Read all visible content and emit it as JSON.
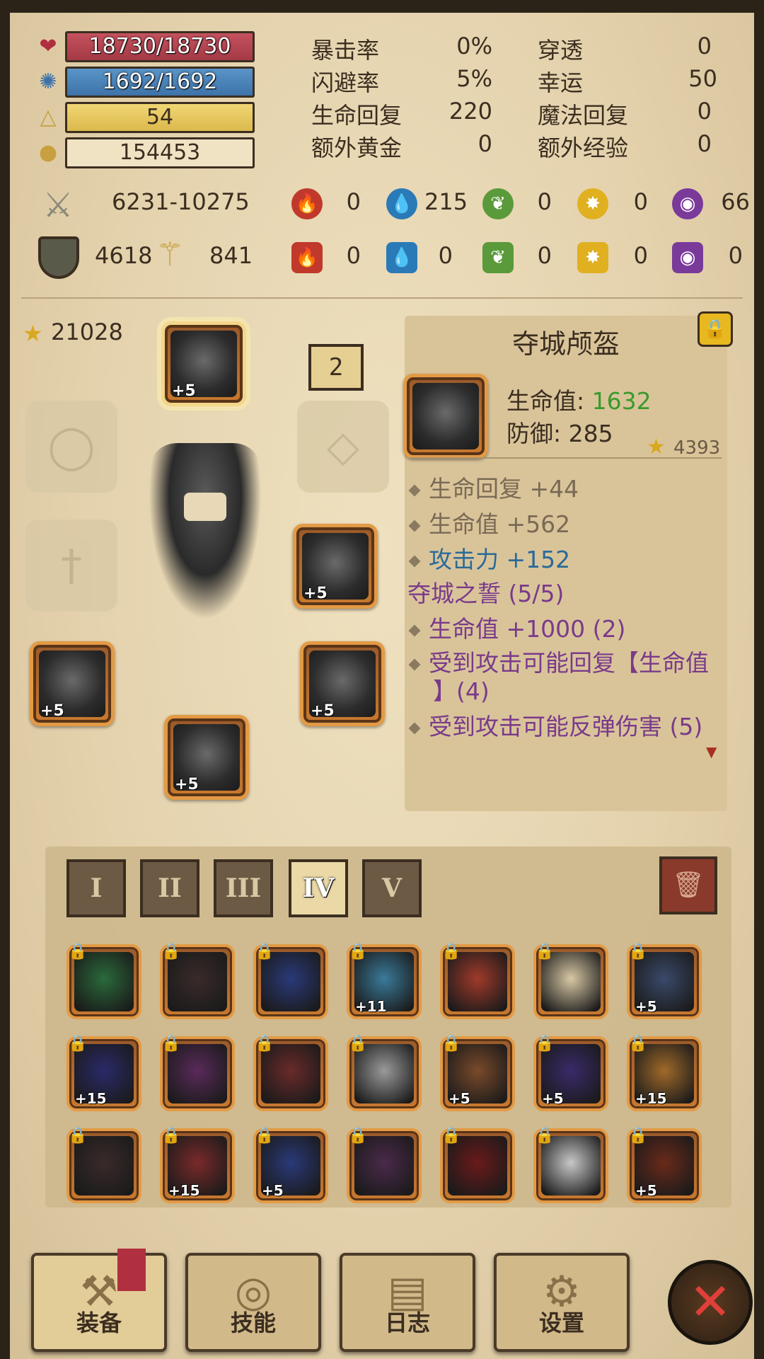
{
  "stats": {
    "hp": "18730/18730",
    "mp": "1692/1692",
    "level": "54",
    "gold": "154453"
  },
  "attributes": [
    {
      "label": "暴击率",
      "value": "0%"
    },
    {
      "label": "闪避率",
      "value": "5%"
    },
    {
      "label": "生命回复",
      "value": "220"
    },
    {
      "label": "额外黄金",
      "value": "0"
    }
  ],
  "attributes2": [
    {
      "label": "穿透",
      "value": "0"
    },
    {
      "label": "幸运",
      "value": "50"
    },
    {
      "label": "魔法回复",
      "value": "0"
    },
    {
      "label": "额外经验",
      "value": "0"
    }
  ],
  "attack": "6231-10275",
  "defense": "4618",
  "magic_defense": "841",
  "elements_attack": [
    "0",
    "215",
    "0",
    "0",
    "66"
  ],
  "elements_defense": [
    "0",
    "0",
    "0",
    "0",
    "0"
  ],
  "score": "21028",
  "set_count": "2",
  "item": {
    "name": "夺城颅盔",
    "hp_label": "生命值:",
    "hp_value": "1632",
    "def_label": "防御:",
    "def_value": "285",
    "score": "4393",
    "bonus": [
      "生命回复 +44",
      "生命值 +562"
    ],
    "bonus_blue": "攻击力 +152",
    "set_name": "夺城之誓 (5/5)",
    "set_bonus": [
      "生命值 +1000 (2)",
      "受到攻击可能回复【生命值",
      "】(4)",
      "受到攻击可能反弹伤害 (5)"
    ]
  },
  "equipped_plus": [
    "+5",
    "+5",
    "+5",
    "+5",
    "+5"
  ],
  "tabs": [
    "I",
    "II",
    "III",
    "IV",
    "V"
  ],
  "active_tab": "IV",
  "bag_plus": [
    [
      "",
      "",
      "",
      "+11",
      "",
      "",
      "+5"
    ],
    [
      "+15",
      "",
      "",
      "",
      "+5",
      "+5",
      "+15"
    ],
    [
      "",
      "+15",
      "+5",
      "",
      "",
      "",
      "+5"
    ]
  ],
  "nav": [
    "装备",
    "技能",
    "日志",
    "设置"
  ],
  "colors": {
    "hp": "#a33a46",
    "mp": "#3d73a8",
    "level": "#dbb94c",
    "green": "#3a9a2a",
    "blue": "#2a6a98",
    "purple": "#7a3a8a"
  }
}
